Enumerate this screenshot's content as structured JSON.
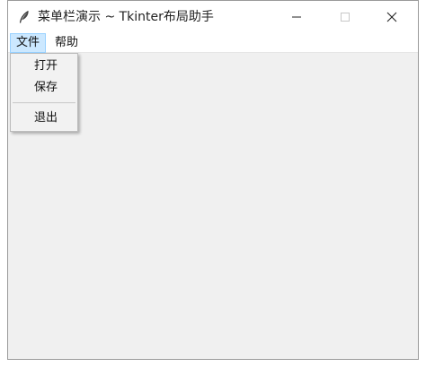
{
  "window": {
    "title": "菜单栏演示 ~ Tkinter布局助手"
  },
  "menubar": {
    "items": [
      {
        "label": "文件"
      },
      {
        "label": "帮助"
      }
    ]
  },
  "file_menu": {
    "items": [
      {
        "label": "打开"
      },
      {
        "label": "保存"
      },
      {
        "label": "退出"
      }
    ]
  },
  "icons": {
    "app": "feather-icon",
    "minimize": "minimize-icon",
    "maximize": "maximize-icon",
    "close": "close-icon"
  },
  "colors": {
    "menu_highlight": "#cce8ff",
    "content_background": "#f0f0f0"
  }
}
